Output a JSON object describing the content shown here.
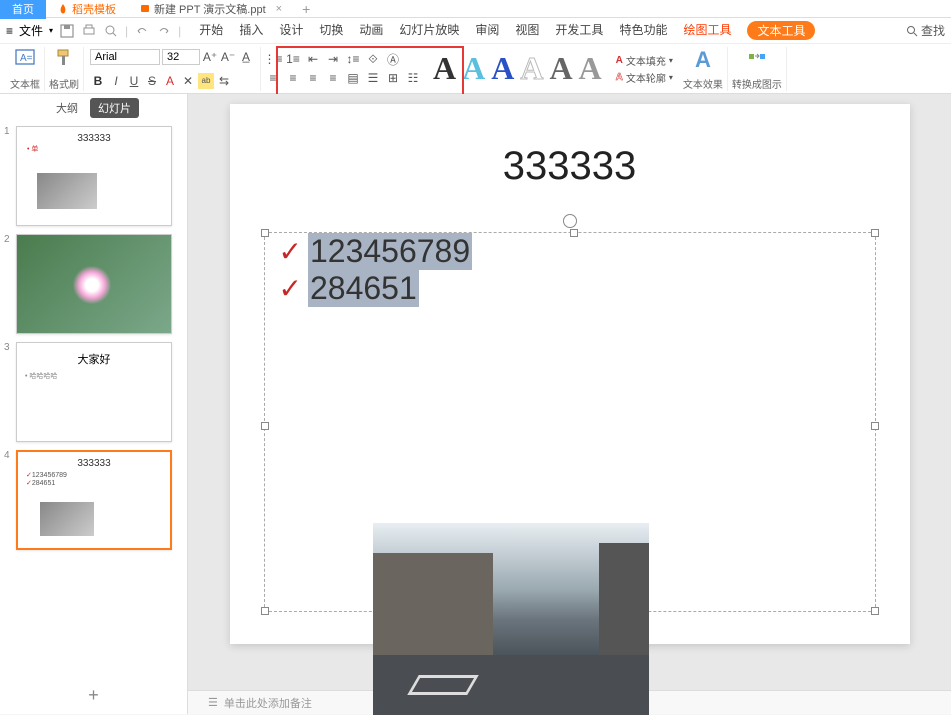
{
  "tabs": {
    "home": "首页",
    "doke": "稻壳模板",
    "ppt": "新建 PPT 演示文稿.ppt",
    "add": "+"
  },
  "menu": {
    "file": "文件",
    "items": [
      "开始",
      "插入",
      "设计",
      "切换",
      "动画",
      "幻灯片放映",
      "审阅",
      "视图",
      "开发工具",
      "特色功能"
    ],
    "drawing_tools": "绘图工具",
    "text_tools": "文本工具",
    "search": "查找"
  },
  "ribbon": {
    "textbox": "文本框",
    "format_painter": "格式刷",
    "font_name": "Arial",
    "font_size": "32",
    "text_fill": "文本填充",
    "text_outline": "文本轮廓",
    "text_effects": "文本效果",
    "convert_diagram": "转换成图示",
    "wa_letter": "A"
  },
  "panel": {
    "outline": "大纲",
    "slides": "幻灯片",
    "thumbs": [
      {
        "num": "1",
        "title": "333333"
      },
      {
        "num": "2",
        "title": ""
      },
      {
        "num": "3",
        "title": "大家好",
        "text": "哈哈哈哈"
      },
      {
        "num": "4",
        "title": "333333",
        "b1": "123456789",
        "b2": "284651"
      }
    ],
    "add": "+"
  },
  "slide": {
    "title": "333333",
    "bullet1": "123456789",
    "bullet2": "284651",
    "check": "✓"
  },
  "notes": {
    "placeholder": "单击此处添加备注"
  }
}
